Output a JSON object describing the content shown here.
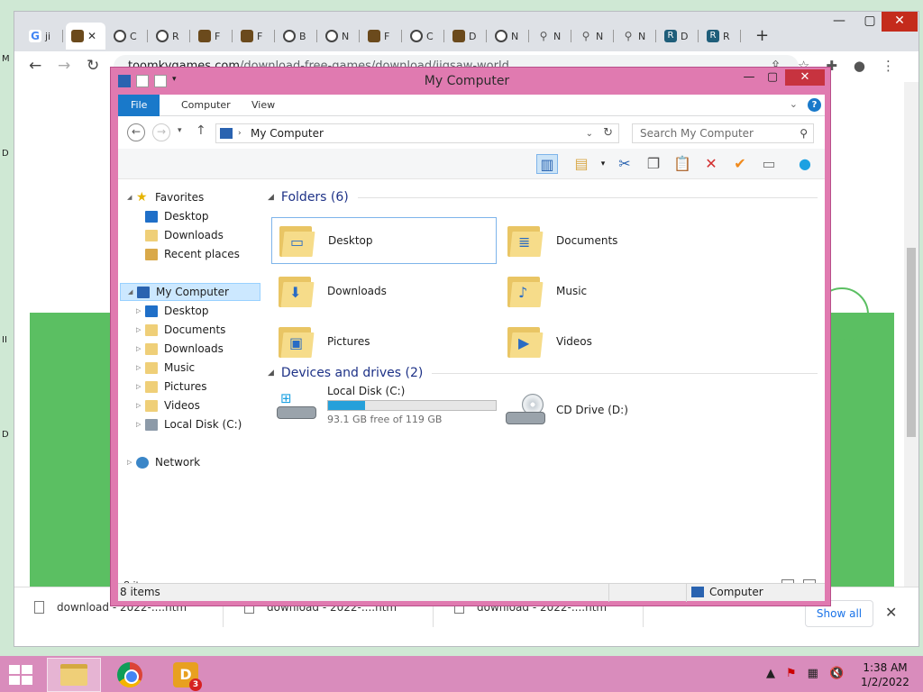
{
  "browser": {
    "tabs": [
      {
        "icon": "google-icon",
        "label": "ji"
      },
      {
        "icon": "cat-icon",
        "label": "",
        "active": true
      },
      {
        "icon": "web-icon",
        "label": "C"
      },
      {
        "icon": "web-icon",
        "label": "R"
      },
      {
        "icon": "cat-icon",
        "label": "F"
      },
      {
        "icon": "cat-icon",
        "label": "F"
      },
      {
        "icon": "web-icon",
        "label": "B"
      },
      {
        "icon": "web-icon",
        "label": "N"
      },
      {
        "icon": "cat-icon",
        "label": "F"
      },
      {
        "icon": "web-icon",
        "label": "C"
      },
      {
        "icon": "cat-icon",
        "label": "D"
      },
      {
        "icon": "web-icon",
        "label": "N"
      },
      {
        "icon": "search-icon",
        "label": "N"
      },
      {
        "icon": "search-icon",
        "label": "N"
      },
      {
        "icon": "search-icon",
        "label": "N"
      },
      {
        "icon": "r-icon",
        "label": "D"
      },
      {
        "icon": "r-icon",
        "label": "R"
      }
    ],
    "url_host": "toomkygames.com",
    "url_path": "/download-free-games/download/jigsaw-world",
    "downloads": [
      {
        "label": "download - 2022-....htm"
      },
      {
        "label": "download - 2022-....htm"
      },
      {
        "label": "download - 2022-....htm"
      }
    ],
    "show_all_label": "Show all"
  },
  "explorer": {
    "title": "My Computer",
    "ribbon_tabs": [
      "File",
      "Computer",
      "View"
    ],
    "address": "My Computer",
    "search_placeholder": "Search My Computer",
    "nav": {
      "favorites_label": "Favorites",
      "favorites": [
        "Desktop",
        "Downloads",
        "Recent places"
      ],
      "computer_label": "My Computer",
      "computer_children": [
        "Desktop",
        "Documents",
        "Downloads",
        "Music",
        "Pictures",
        "Videos",
        "Local Disk (C:)"
      ],
      "network_label": "Network"
    },
    "folders_header": "Folders (6)",
    "folders": [
      "Desktop",
      "Documents",
      "Downloads",
      "Music",
      "Pictures",
      "Videos"
    ],
    "devices_header": "Devices and drives (2)",
    "drives": [
      {
        "name": "Local Disk (C:)",
        "free": "93.1 GB free of 119 GB",
        "used_fraction": 0.218
      },
      {
        "name": "CD Drive (D:)"
      }
    ],
    "inner_status": "8 items",
    "outer_status_left": "8 items",
    "outer_status_right": "Computer"
  },
  "taskbar": {
    "time": "1:38 AM",
    "date": "1/2/2022",
    "d_badge": "3",
    "d_letter": "D"
  },
  "colors": {
    "accent": "#1979ca",
    "frame": "#e07ab0",
    "taskbar": "#d98cbc",
    "page_green": "#5bbf62"
  }
}
